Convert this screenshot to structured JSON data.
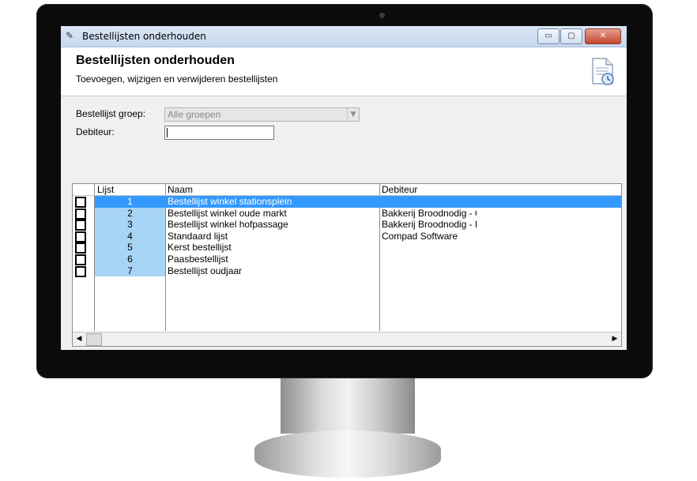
{
  "window": {
    "title": "Bestellijsten onderhouden",
    "controls": {
      "minimize": "▭",
      "maximize": "▢",
      "close": "✕"
    }
  },
  "header": {
    "title": "Bestellijsten onderhouden",
    "subtitle": "Toevoegen, wijzigen en verwijderen bestellijsten"
  },
  "form": {
    "group_label": "Bestellijst groep:",
    "group_value": "Alle groepen",
    "debiteur_label": "Debiteur:",
    "debiteur_value": ""
  },
  "grid": {
    "columns": [
      "Lijst",
      "Naam",
      "Debiteur"
    ],
    "rows": [
      {
        "lijst": "1",
        "naam": "Bestellijst winkel stationsplein",
        "debiteur": "",
        "selected": true
      },
      {
        "lijst": "2",
        "naam": "Bestellijst winkel oude markt",
        "debiteur": "Bakkerij Broodnodig - Oude mar",
        "selected": false
      },
      {
        "lijst": "3",
        "naam": "Bestellijst winkel hofpassage",
        "debiteur": "Bakkerij Broodnodig - Hofpassa",
        "selected": false
      },
      {
        "lijst": "4",
        "naam": "Standaard lijst",
        "debiteur": "Compad Software",
        "selected": false
      },
      {
        "lijst": "5",
        "naam": "Kerst bestellijst",
        "debiteur": "",
        "selected": false
      },
      {
        "lijst": "6",
        "naam": "Paasbestellijst",
        "debiteur": "",
        "selected": false
      },
      {
        "lijst": "7",
        "naam": "Bestellijst oudjaar",
        "debiteur": "",
        "selected": false
      }
    ]
  },
  "colors": {
    "selection": "#3399ff",
    "number_cell": "#a8d4f5",
    "titlebar": "#c7d8ee"
  }
}
